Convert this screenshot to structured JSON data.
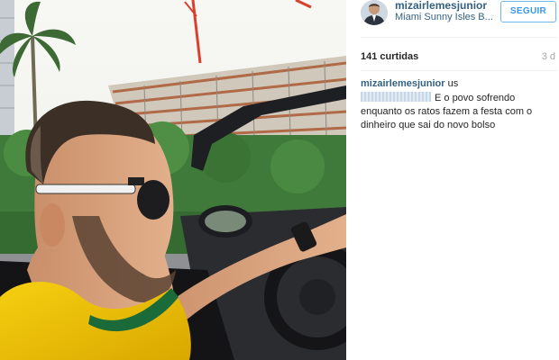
{
  "profile": {
    "username": "mizairlemesjunior",
    "location": "Miami Sunny Isles B..."
  },
  "follow_button": {
    "label": "SEGUIR"
  },
  "stats": {
    "likes": "141 curtidas",
    "time_ago": "3 d"
  },
  "caption": {
    "user": "mizairlemesjunior",
    "text_part": "us",
    "comment": "E o povo sofrendo enquanto os ratos fazem a festa com o dinheiro que sai do novo bolso"
  },
  "colors": {
    "link": "#34617f",
    "follow_border": "#70b7ec",
    "shirt": "#f2c400",
    "sky": "#f4f6f3"
  }
}
